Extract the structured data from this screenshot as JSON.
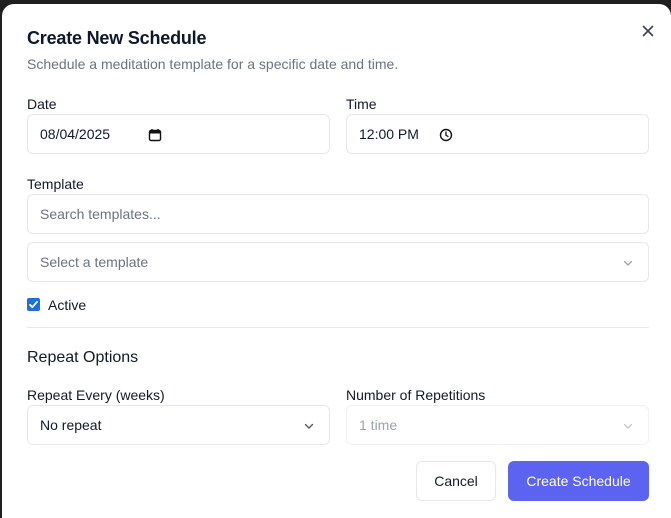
{
  "dialog": {
    "title": "Create New Schedule",
    "subtitle": "Schedule a meditation template for a specific date and time.",
    "close_icon": "close-icon"
  },
  "date": {
    "label": "Date",
    "value": "08/04/2025",
    "icon": "calendar-icon"
  },
  "time": {
    "label": "Time",
    "value": "12:00 PM",
    "icon": "clock-icon"
  },
  "template": {
    "label": "Template",
    "search_placeholder": "Search templates...",
    "select_placeholder": "Select a template",
    "icon": "chevron-down-icon"
  },
  "active": {
    "label": "Active",
    "checked": true,
    "color": "#1d6fe0"
  },
  "repeat": {
    "section_title": "Repeat Options",
    "every_label": "Repeat Every (weeks)",
    "every_value": "No repeat",
    "reps_label": "Number of Repetitions",
    "reps_value": "1 time"
  },
  "actions": {
    "cancel_label": "Cancel",
    "create_label": "Create Schedule",
    "primary_color": "#5b63f0"
  }
}
